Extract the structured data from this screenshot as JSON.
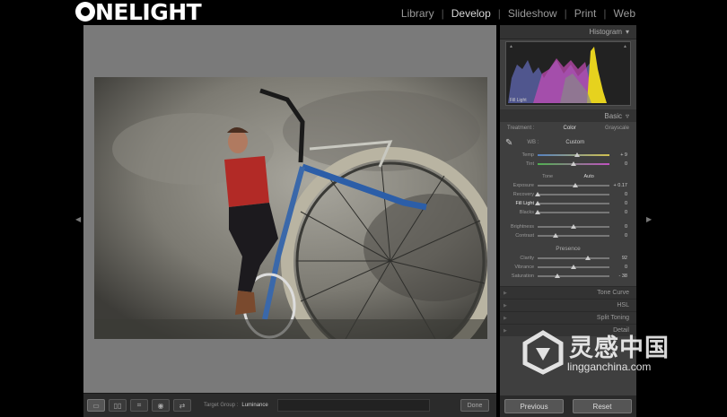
{
  "app": {
    "logo_text": "NELIGHT",
    "modules": [
      "Library",
      "Develop",
      "Slideshow",
      "Print",
      "Web"
    ],
    "active_module": "Develop"
  },
  "right_panel": {
    "histogram_title": "Histogram",
    "histogram_label": "Fill Light",
    "basic_title": "Basic",
    "treatment_label": "Treatment :",
    "treatment_color": "Color",
    "treatment_grayscale": "Grayscale",
    "wb_label": "WB :",
    "wb_value": "Custom",
    "temp": {
      "label": "Temp",
      "value": "+ 9",
      "level": 0.55
    },
    "tint": {
      "label": "Tint",
      "value": "0",
      "level": 0.5
    },
    "tone_label": "Tone",
    "tone_auto": "Auto",
    "exposure": {
      "label": "Exposure",
      "value": "+ 0.17",
      "level": 0.52
    },
    "recovery": {
      "label": "Recovery",
      "value": "0",
      "level": 0.0
    },
    "fill_light": {
      "label": "Fill Light",
      "value": "0",
      "level": 0.0
    },
    "blacks": {
      "label": "Blacks",
      "value": "0",
      "level": 0.0
    },
    "brightness": {
      "label": "Brightness",
      "value": "0",
      "level": 0.5
    },
    "contrast": {
      "label": "Contrast",
      "value": "0",
      "level": 0.25
    },
    "presence_title": "Presence",
    "clarity": {
      "label": "Clarity",
      "value": "92",
      "level": 0.7
    },
    "vibrance": {
      "label": "Vibrance",
      "value": "0",
      "level": 0.5
    },
    "saturation": {
      "label": "Saturation",
      "value": "- 38",
      "level": 0.28
    },
    "tone_curve_title": "Tone Curve",
    "hsl_title": "HSL",
    "split_toning_title": "Split Toning",
    "detail_title": "Detail",
    "previous_label": "Previous",
    "reset_label": "Reset"
  },
  "toolbar": {
    "target_group_label": "Target Group :",
    "target_group_value": "Luminance",
    "done_label": "Done"
  },
  "watermark": {
    "cn": "灵感中国",
    "en": "lingganchina.com"
  }
}
